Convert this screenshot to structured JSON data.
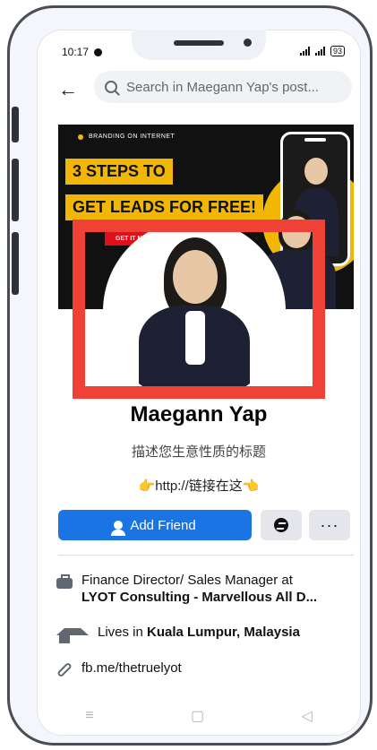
{
  "status": {
    "time": "10:17",
    "right": "93"
  },
  "header": {
    "back_icon": "arrow-left-icon",
    "search_placeholder": "Search in Maegann Yap's post..."
  },
  "cover": {
    "tag": "BRANDING ON INTERNET",
    "line1": "3 STEPS TO",
    "line2": "GET LEADS FOR FREE!",
    "cta": "GET IT NOW"
  },
  "profile": {
    "name": "Maegann Yap",
    "subtitle": "描述您生意性质的标题",
    "link_line": "👉http://链接在这👈"
  },
  "actions": {
    "add_friend": "Add Friend",
    "messenger_icon": "messenger-icon",
    "more": "···"
  },
  "info": {
    "work_prefix": "Finance Director/ Sales Manager at",
    "work_company": "LYOT Consulting - Marvellous All D...",
    "lives_prefix": "Lives in",
    "lives_place": "Kuala Lumpur, Malaysia",
    "link": "fb.me/thetruelyot"
  },
  "nav": {
    "menu": "≡",
    "home": "▢",
    "back": "◁"
  },
  "colors": {
    "accent": "#1b74e4",
    "highlight": "#ef4135",
    "cover_yellow": "#f2b705"
  }
}
